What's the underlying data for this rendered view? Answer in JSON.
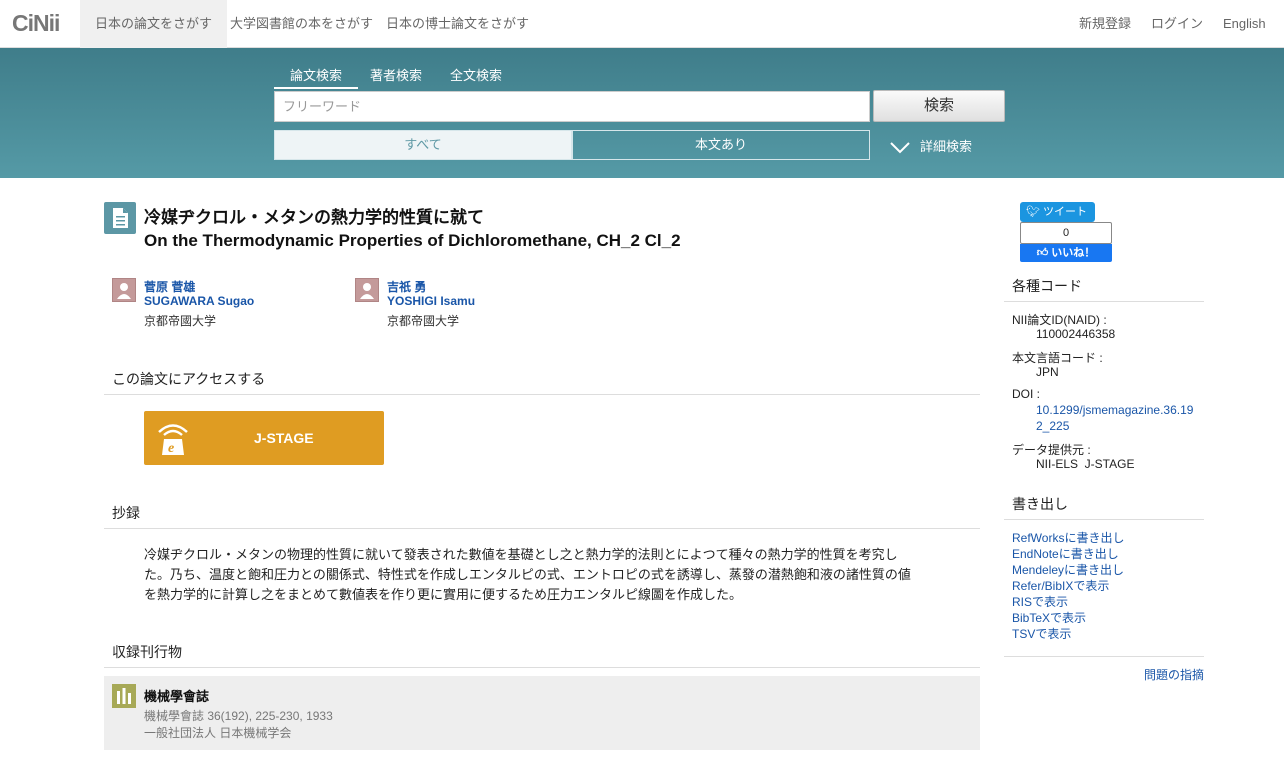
{
  "nav": {
    "logo": "CiNii",
    "tabs": [
      "日本の論文をさがす",
      "大学図書館の本をさがす",
      "日本の博士論文をさがす"
    ],
    "register": "新規登録",
    "login": "ログイン",
    "english": "English"
  },
  "search": {
    "tabs": [
      "論文検索",
      "著者検索",
      "全文検索"
    ],
    "placeholder": "フリーワード",
    "button": "検索",
    "filter_all": "すべて",
    "filter_fulltext": "本文あり",
    "advanced": "詳細検索"
  },
  "article": {
    "title_ja": "冷媒ヂクロル・メタンの熱力学的性質に就て",
    "title_en": "On the Thermodynamic Properties of Dichloromethane, CH_2 Cl_2",
    "authors": [
      {
        "name_ja": "菅原 菅雄",
        "name_en": "SUGAWARA Sugao",
        "affiliation": "京都帝國大学"
      },
      {
        "name_ja": "吉祇 勇",
        "name_en": "YOSHIGI Isamu",
        "affiliation": "京都帝國大学"
      }
    ]
  },
  "access": {
    "heading": "この論文にアクセスする",
    "jstage_label": "J-STAGE"
  },
  "abstract": {
    "heading": "抄録",
    "lines": [
      "冷媒ヂクロル・メタンの物理的性質に就いて發表された數値を基礎とし之と熱力学的法則とによつて種々の熱力学的性質を考究し",
      "た。乃ち、温度と飽和圧力との關係式、特性式を作成しエンタルピの式、エントロピの式を誘導し、蒸發の潜熱飽和液の諸性質の値",
      "を熱力学的に計算し之をまとめて數値表を作り更に實用に便するため圧力エンタルピ線圖を作成した。"
    ]
  },
  "journal": {
    "heading": "収録刊行物",
    "title": "機械學會誌",
    "detail": "機械學會誌 36(192), 225-230, 1933",
    "publisher": "一般社団法人 日本機械学会"
  },
  "social": {
    "tweet": "ツイート",
    "fb_count": "0",
    "fb_like": "いいね！"
  },
  "codes": {
    "heading": "各種コード",
    "naid_label": "NII論文ID(NAID) :",
    "naid": "110002446358",
    "lang_label": "本文言語コード :",
    "lang": "JPN",
    "doi_label": "DOI :",
    "doi": "10.1299/jsmemagazine.36.192_225",
    "provider_label": "データ提供元 :",
    "provider": "NII-ELS  J-STAGE"
  },
  "export": {
    "heading": "書き出し",
    "links": [
      "RefWorksに書き出し",
      "EndNoteに書き出し",
      "Mendeleyに書き出し",
      "Refer/BibIXで表示",
      "RISで表示",
      "BibTeXで表示",
      "TSVで表示"
    ]
  },
  "report": "問題の指摘",
  "colors": {
    "band": "#4a8c99",
    "accent_link": "#1a56a8",
    "jstage": "#df9c22"
  }
}
